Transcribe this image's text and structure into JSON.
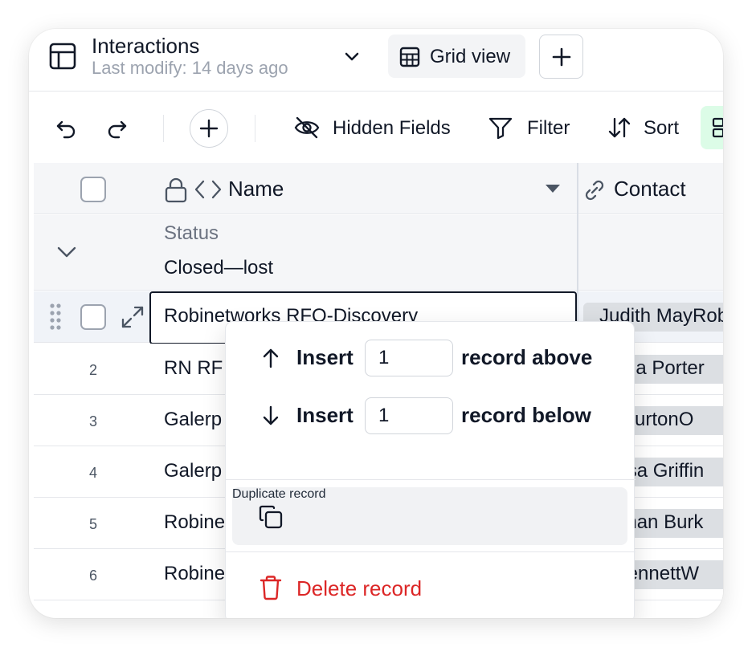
{
  "header": {
    "title": "Interactions",
    "subtitle": "Last modify: 14 days ago",
    "view_label": "Grid view"
  },
  "toolbar": {
    "hidden_fields": "Hidden Fields",
    "filter": "Filter",
    "sort": "Sort"
  },
  "columns": {
    "name": "Name",
    "contact": "Contact"
  },
  "group": {
    "label": "Status",
    "value": "Closed—lost"
  },
  "rows": [
    {
      "num": "",
      "name": "Robinetworks RFQ-Discovery",
      "contact": "Judith MayRob"
    },
    {
      "num": "2",
      "name": "RN RF",
      "contact": "ctoria Porter"
    },
    {
      "num": "3",
      "name": "Galerp",
      "contact": "ra BurtonO"
    },
    {
      "num": "4",
      "name": "Galerp",
      "contact": "eresa Griffin"
    },
    {
      "num": "5",
      "name": "Robine",
      "contact": "nathan Burk"
    },
    {
      "num": "6",
      "name": "Robine",
      "contact": "y BennettW"
    }
  ],
  "context_menu": {
    "insert_label": "Insert",
    "above_count": "1",
    "above_suffix": "record above",
    "below_count": "1",
    "below_suffix": "record below",
    "duplicate": "Duplicate record",
    "delete": "Delete record"
  },
  "colors": {
    "accent_green": "#dcfce7",
    "danger": "#dc2626",
    "chip_bg": "#dcdfe3"
  }
}
